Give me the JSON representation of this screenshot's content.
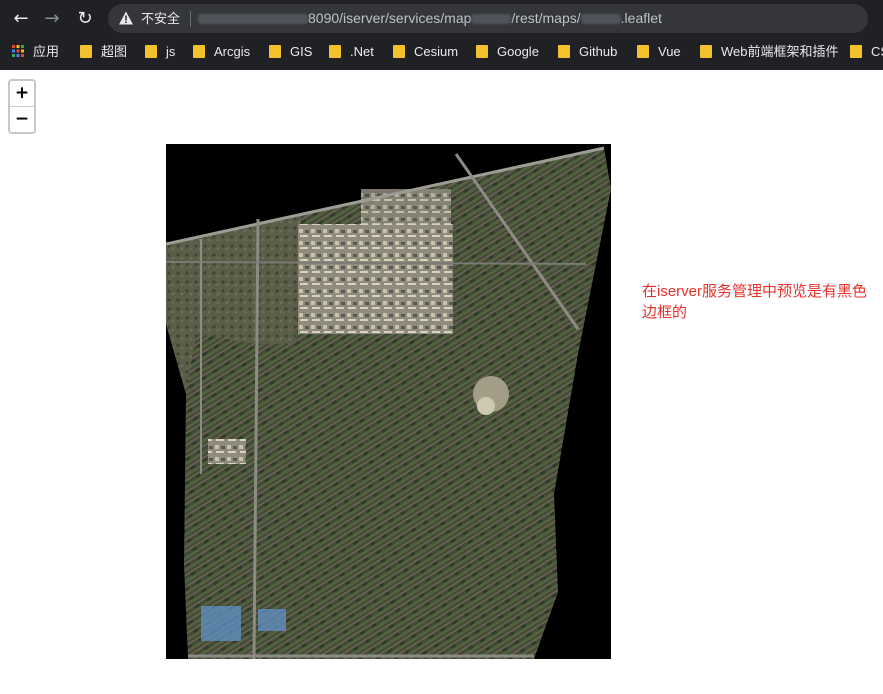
{
  "browser": {
    "security_label": "不安全",
    "url_visible_parts": [
      "8090/iserver/services/map",
      "/rest/maps/",
      ".leaflet"
    ],
    "bookmarks": [
      {
        "label": "应用",
        "icon": "apps-grid-icon"
      },
      {
        "label": "超图",
        "icon": "folder-icon"
      },
      {
        "label": "js",
        "icon": "folder-icon"
      },
      {
        "label": "Arcgis",
        "icon": "folder-icon"
      },
      {
        "label": "GIS",
        "icon": "folder-icon"
      },
      {
        "label": ".Net",
        "icon": "folder-icon"
      },
      {
        "label": "Cesium",
        "icon": "folder-icon"
      },
      {
        "label": "Google",
        "icon": "folder-icon"
      },
      {
        "label": "Github",
        "icon": "folder-icon"
      },
      {
        "label": "Vue",
        "icon": "folder-icon"
      },
      {
        "label": "Web前端框架和插件",
        "icon": "folder-icon"
      },
      {
        "label": "CS",
        "icon": "folder-icon"
      }
    ]
  },
  "map": {
    "zoom_in_label": "+",
    "zoom_out_label": "−",
    "tile_background": "#000000"
  },
  "annotation": {
    "text": "在iserver服务管理中预览是有黑色边框的",
    "color": "#e8312c"
  }
}
